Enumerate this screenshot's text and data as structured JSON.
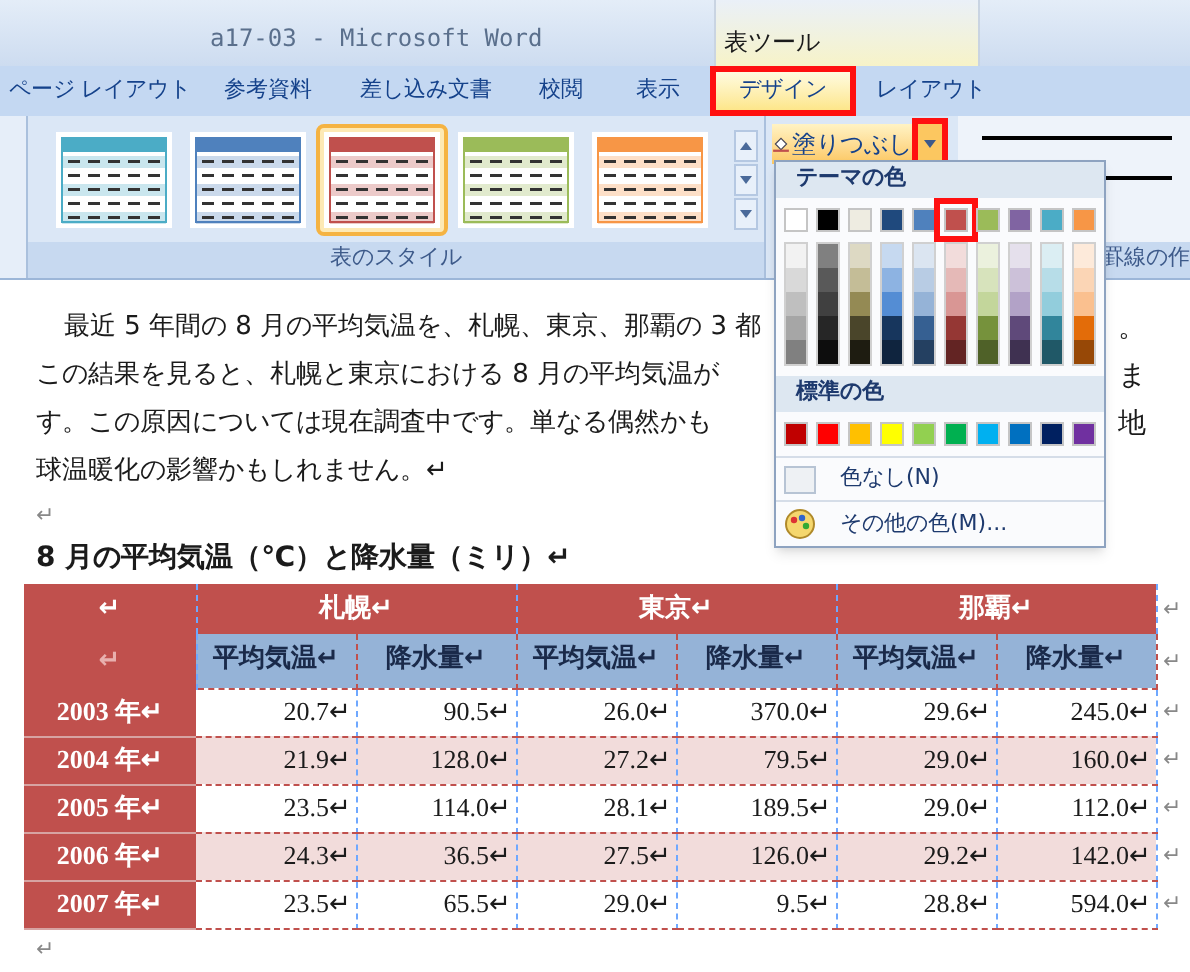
{
  "window": {
    "title": "a17-03 - Microsoft Word",
    "context_group": "表ツール"
  },
  "tabs": [
    {
      "label": "ページ レイアウト",
      "selected": false,
      "highlighted": false
    },
    {
      "label": "参考資料",
      "selected": false,
      "highlighted": false
    },
    {
      "label": "差し込み文書",
      "selected": false,
      "highlighted": false
    },
    {
      "label": "校閲",
      "selected": false,
      "highlighted": false
    },
    {
      "label": "表示",
      "selected": false,
      "highlighted": false
    },
    {
      "label": "デザイン",
      "selected": true,
      "highlighted": true
    },
    {
      "label": "レイアウト",
      "selected": false,
      "highlighted": false
    }
  ],
  "ribbon": {
    "styles_group": {
      "label": "表のスタイル",
      "gallery": [
        {
          "color": "#4bacc6",
          "selected": false
        },
        {
          "color": "#4f81bd",
          "selected": false
        },
        {
          "color": "#c0504d",
          "selected": true
        },
        {
          "color": "#9bbb59",
          "selected": false
        },
        {
          "color": "#f79646",
          "selected": false
        }
      ]
    },
    "fill_button": {
      "label": "塗りつぶし",
      "arrow_highlighted": true
    },
    "borders_group_label": "罫線の作"
  },
  "color_menu": {
    "theme_header": "テーマの色",
    "theme_colors": [
      {
        "color": "#ffffff",
        "selected": false,
        "shades": [
          {
            "color": "#f2f2f2"
          },
          {
            "color": "#d9d9d9"
          },
          {
            "color": "#bfbfbf"
          },
          {
            "color": "#a6a6a6"
          },
          {
            "color": "#808080"
          }
        ]
      },
      {
        "color": "#000000",
        "selected": false,
        "shades": [
          {
            "color": "#808080"
          },
          {
            "color": "#595959"
          },
          {
            "color": "#404040"
          },
          {
            "color": "#262626"
          },
          {
            "color": "#0d0d0d"
          }
        ]
      },
      {
        "color": "#eeece1",
        "selected": false,
        "shades": [
          {
            "color": "#ddd9c3"
          },
          {
            "color": "#c4bd97"
          },
          {
            "color": "#948a54"
          },
          {
            "color": "#4a452a"
          },
          {
            "color": "#1e1c11"
          }
        ]
      },
      {
        "color": "#1f497d",
        "selected": false,
        "shades": [
          {
            "color": "#c6d9f0"
          },
          {
            "color": "#8db3e2"
          },
          {
            "color": "#548dd4"
          },
          {
            "color": "#17365d"
          },
          {
            "color": "#0f243e"
          }
        ]
      },
      {
        "color": "#4f81bd",
        "selected": false,
        "shades": [
          {
            "color": "#dbe5f1"
          },
          {
            "color": "#b8cce4"
          },
          {
            "color": "#95b3d7"
          },
          {
            "color": "#366092"
          },
          {
            "color": "#244061"
          }
        ]
      },
      {
        "color": "#c0504d",
        "selected": true,
        "shades": [
          {
            "color": "#f2dcdb"
          },
          {
            "color": "#e5b9b7"
          },
          {
            "color": "#d99694"
          },
          {
            "color": "#953734"
          },
          {
            "color": "#632423"
          }
        ]
      },
      {
        "color": "#9bbb59",
        "selected": false,
        "shades": [
          {
            "color": "#ebf1dd"
          },
          {
            "color": "#d7e3bc"
          },
          {
            "color": "#c3d69b"
          },
          {
            "color": "#76923c"
          },
          {
            "color": "#4f6128"
          }
        ]
      },
      {
        "color": "#8064a2",
        "selected": false,
        "shades": [
          {
            "color": "#e5e0ec"
          },
          {
            "color": "#ccc1d9"
          },
          {
            "color": "#b2a2c7"
          },
          {
            "color": "#5f497a"
          },
          {
            "color": "#3f3151"
          }
        ]
      },
      {
        "color": "#4bacc6",
        "selected": false,
        "shades": [
          {
            "color": "#dbeef3"
          },
          {
            "color": "#b7dde8"
          },
          {
            "color": "#92cddc"
          },
          {
            "color": "#31859b"
          },
          {
            "color": "#205867"
          }
        ]
      },
      {
        "color": "#f79646",
        "selected": false,
        "shades": [
          {
            "color": "#fdeada"
          },
          {
            "color": "#fbd5b5"
          },
          {
            "color": "#fac08f"
          },
          {
            "color": "#e36c09"
          },
          {
            "color": "#974806"
          }
        ]
      }
    ],
    "standard_header": "標準の色",
    "standard_colors": [
      {
        "color": "#c00000"
      },
      {
        "color": "#ff0000"
      },
      {
        "color": "#ffc000"
      },
      {
        "color": "#ffff00"
      },
      {
        "color": "#92d050"
      },
      {
        "color": "#00b050"
      },
      {
        "color": "#00b0f0"
      },
      {
        "color": "#0070c0"
      },
      {
        "color": "#002060"
      },
      {
        "color": "#7030a0"
      }
    ],
    "no_color": "色なし(N)",
    "more_colors": "その他の色(M)..."
  },
  "document": {
    "paragraph_lines": [
      {
        "left": "最近 5 年間の 8 月の平均気温を、札幌、東京、那覇の 3 都",
        "right": "。"
      },
      {
        "left": "この結果を見ると、札幌と東京における 8 月の平均気温が",
        "right": "ま"
      },
      {
        "left": "す。この原因については現在調査中です。単なる偶然かも",
        "right": "地"
      },
      {
        "left": "球温暖化の影響かもしれません。↵"
      }
    ],
    "empty_mark": "↵",
    "heading": "8 月の平均気温（℃）と降水量（ミリ）↵",
    "table": {
      "header": [
        "↵",
        "札幌↵",
        "東京↵",
        "那覇↵"
      ],
      "header_end": "↵",
      "subheader": [
        "↵",
        "平均気温↵",
        "降水量↵",
        "平均気温↵",
        "降水量↵",
        "平均気温↵",
        "降水量↵"
      ],
      "subheader_end": "↵",
      "rows": [
        {
          "year": "2003 年↵",
          "cells": [
            "20.7↵",
            "90.5↵",
            "26.0↵",
            "370.0↵",
            "29.6↵",
            "245.0↵"
          ],
          "end": "↵"
        },
        {
          "year": "2004 年↵",
          "cells": [
            "21.9↵",
            "128.0↵",
            "27.2↵",
            "79.5↵",
            "29.0↵",
            "160.0↵"
          ],
          "end": "↵"
        },
        {
          "year": "2005 年↵",
          "cells": [
            "23.5↵",
            "114.0↵",
            "28.1↵",
            "189.5↵",
            "29.0↵",
            "112.0↵"
          ],
          "end": "↵"
        },
        {
          "year": "2006 年↵",
          "cells": [
            "24.3↵",
            "36.5↵",
            "27.5↵",
            "126.0↵",
            "29.2↵",
            "142.0↵"
          ],
          "end": "↵"
        },
        {
          "year": "2007 年↵",
          "cells": [
            "23.5↵",
            "65.5↵",
            "29.0↵",
            "9.5↵",
            "28.8↵",
            "594.0↵"
          ],
          "end": "↵"
        }
      ]
    },
    "end_mark": "↵"
  }
}
